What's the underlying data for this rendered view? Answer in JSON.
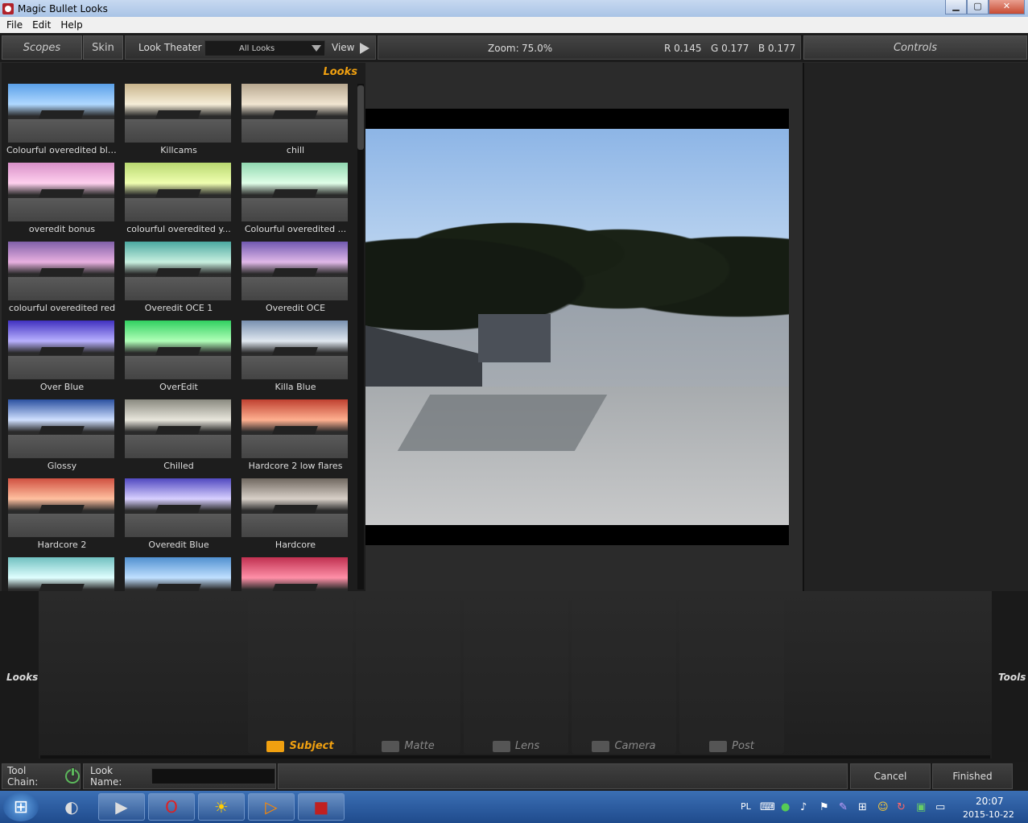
{
  "window": {
    "title": "Magic Bullet Looks",
    "minimize": "▁",
    "maximize": "▢",
    "close": "✕"
  },
  "menu": [
    "File",
    "Edit",
    "Help"
  ],
  "topbar": {
    "scopes": "Scopes",
    "skin": "Skin",
    "look_theater": "Look Theater",
    "looks_filter": "All Looks",
    "view": "View",
    "zoom_label": "Zoom:",
    "zoom_value": "75.0%",
    "rgb": "R 0.145   G 0.177   B 0.177",
    "controls": "Controls"
  },
  "looks_panel": {
    "header": "Looks",
    "items": [
      {
        "label": "Colourful overedited blue",
        "sky": "#5aa0e8",
        "tint": "#b0d8ff"
      },
      {
        "label": "Killcams",
        "sky": "#c8b48c",
        "tint": "#f6eed8"
      },
      {
        "label": "chill",
        "sky": "#b8a890",
        "tint": "#f2e6d2"
      },
      {
        "label": "overedit bonus",
        "sky": "#d890c8",
        "tint": "#ffd0ee"
      },
      {
        "label": "colourful overedited y...",
        "sky": "#b8d870",
        "tint": "#f0ffb0"
      },
      {
        "label": "Colourful overedited ...",
        "sky": "#90d8b0",
        "tint": "#e0ffe8"
      },
      {
        "label": "colourful overedited red",
        "sky": "#8060a8",
        "tint": "#e8b0e0"
      },
      {
        "label": "Overedit OCE 1",
        "sky": "#4aa8a0",
        "tint": "#c8f0e0"
      },
      {
        "label": "Overedit OCE",
        "sky": "#7058b0",
        "tint": "#e0b8e8"
      },
      {
        "label": "Over Blue",
        "sky": "#4030c0",
        "tint": "#b8b0ff"
      },
      {
        "label": "OverEdit",
        "sky": "#30d060",
        "tint": "#b0ffb8"
      },
      {
        "label": "Killa Blue",
        "sky": "#7890b0",
        "tint": "#e0e8f0"
      },
      {
        "label": "Glossy",
        "sky": "#2a50a0",
        "tint": "#d0e0ff"
      },
      {
        "label": "Chilled",
        "sky": "#8a8a80",
        "tint": "#e8e6dc"
      },
      {
        "label": "Hardcore 2 low flares",
        "sky": "#c04030",
        "tint": "#ffb090"
      },
      {
        "label": "Hardcore 2",
        "sky": "#d05040",
        "tint": "#ffc0a0"
      },
      {
        "label": "Overedit Blue",
        "sky": "#5048c0",
        "tint": "#d8d0ff"
      },
      {
        "label": "Hardcore",
        "sky": "#706860",
        "tint": "#d8d0c8"
      },
      {
        "label": "",
        "sky": "#70c0c0",
        "tint": "#e0ffff"
      },
      {
        "label": "",
        "sky": "#5090d0",
        "tint": "#c0e0ff"
      },
      {
        "label": "",
        "sky": "#c03050",
        "tint": "#ff90a8"
      }
    ]
  },
  "toolchain": {
    "left_label": "Looks",
    "right_label": "Tools",
    "stages": [
      {
        "label": "Subject",
        "active": true
      },
      {
        "label": "Matte",
        "active": false
      },
      {
        "label": "Lens",
        "active": false
      },
      {
        "label": "Camera",
        "active": false
      },
      {
        "label": "Post",
        "active": false
      }
    ]
  },
  "bottombar": {
    "tool_chain": "Tool Chain:",
    "look_name_label": "Look Name:",
    "look_name_value": "",
    "cancel": "Cancel",
    "finished": "Finished"
  },
  "taskbar": {
    "start_icon": "windows-logo-icon",
    "apps": [
      "media-center-icon",
      "media-player-icon",
      "opera-icon",
      "sun-icon",
      "vlc-icon",
      "magic-bullet-icon"
    ],
    "language": "PL",
    "time": "20:07",
    "date": "2015-10-22"
  }
}
